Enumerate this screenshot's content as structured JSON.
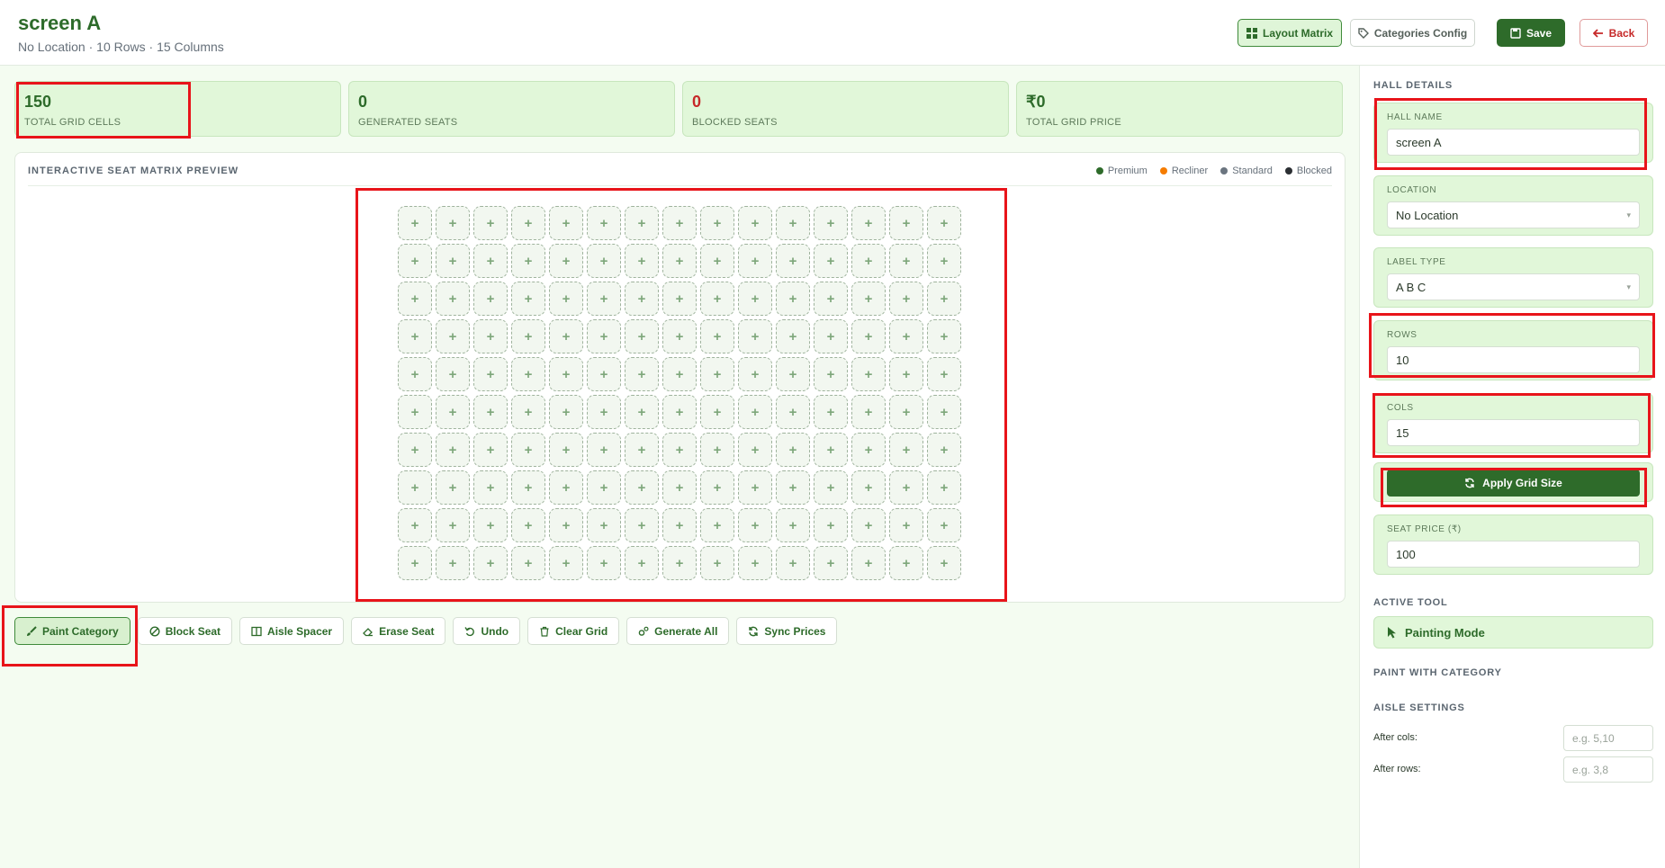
{
  "header": {
    "title": "screen A",
    "subtitle": "No Location · 10 Rows · 15 Columns",
    "buttons": {
      "layout": "Layout Matrix",
      "categories": "Categories Config",
      "save": "Save",
      "back": "Back"
    }
  },
  "stats": [
    {
      "value": "150",
      "label": "TOTAL GRID CELLS"
    },
    {
      "value": "0",
      "label": "GENERATED SEATS"
    },
    {
      "value": "0",
      "label": "BLOCKED SEATS"
    },
    {
      "value": "₹0",
      "label": "TOTAL GRID PRICE"
    }
  ],
  "matrix": {
    "title": "INTERACTIVE SEAT MATRIX PREVIEW",
    "legend": [
      {
        "name": "Premium",
        "color": "#2e6b2a"
      },
      {
        "name": "Recliner",
        "color": "#f57c00"
      },
      {
        "name": "Standard",
        "color": "#6b7580"
      },
      {
        "name": "Blocked",
        "color": "#2b2f33"
      }
    ],
    "rows": 10,
    "cols": 15,
    "cell_symbol": "+"
  },
  "toolbar": {
    "paint": "Paint Category",
    "block": "Block Seat",
    "aisle": "Aisle Spacer",
    "erase": "Erase Seat",
    "undo": "Undo",
    "clear": "Clear Grid",
    "generate": "Generate All",
    "sync": "Sync Prices"
  },
  "sidebar": {
    "heading": "HALL DETAILS",
    "hall_name": {
      "label": "HALL NAME",
      "value": "screen A"
    },
    "location": {
      "label": "LOCATION",
      "value": "No Location"
    },
    "label_type": {
      "label": "LABEL TYPE",
      "value": "A B C"
    },
    "rows": {
      "label": "ROWS",
      "value": "10"
    },
    "cols": {
      "label": "COLS",
      "value": "15"
    },
    "apply_button": "Apply Grid Size",
    "seat_price": {
      "label": "SEAT PRICE (₹)",
      "value": "100"
    },
    "active_tool_heading": "ACTIVE TOOL",
    "active_tool": "Painting Mode",
    "paint_heading": "PAINT WITH CATEGORY",
    "aisle_heading": "AISLE SETTINGS",
    "after_cols": {
      "label": "After cols:",
      "placeholder": "e.g. 5,10"
    },
    "after_rows": {
      "label": "After rows:",
      "placeholder": "e.g. 3,8"
    }
  }
}
